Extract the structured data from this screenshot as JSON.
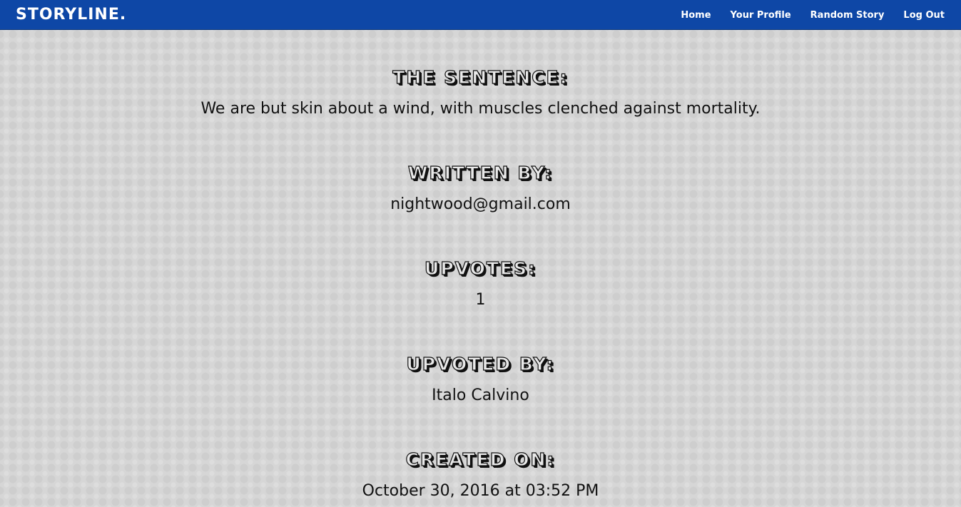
{
  "navbar": {
    "brand": "STORYLINE.",
    "links": [
      "Home",
      "Your Profile",
      "Random Story",
      "Log Out"
    ]
  },
  "details": {
    "sentence_heading": "The Sentence:",
    "sentence": "We are but skin about a wind, with muscles clenched against mortality.",
    "author_heading": "Written By:",
    "author": "nightwood@gmail.com",
    "upvotes_heading": "Upvotes:",
    "upvotes": "1",
    "upvoted_by_heading": "Upvoted By:",
    "upvoted_by": "Italo Calvino",
    "created_heading": "Created On:",
    "created": "October 30, 2016 at 03:52 PM"
  },
  "colors": {
    "navbar": "#0e47a6",
    "background": "#d6d6d6"
  }
}
